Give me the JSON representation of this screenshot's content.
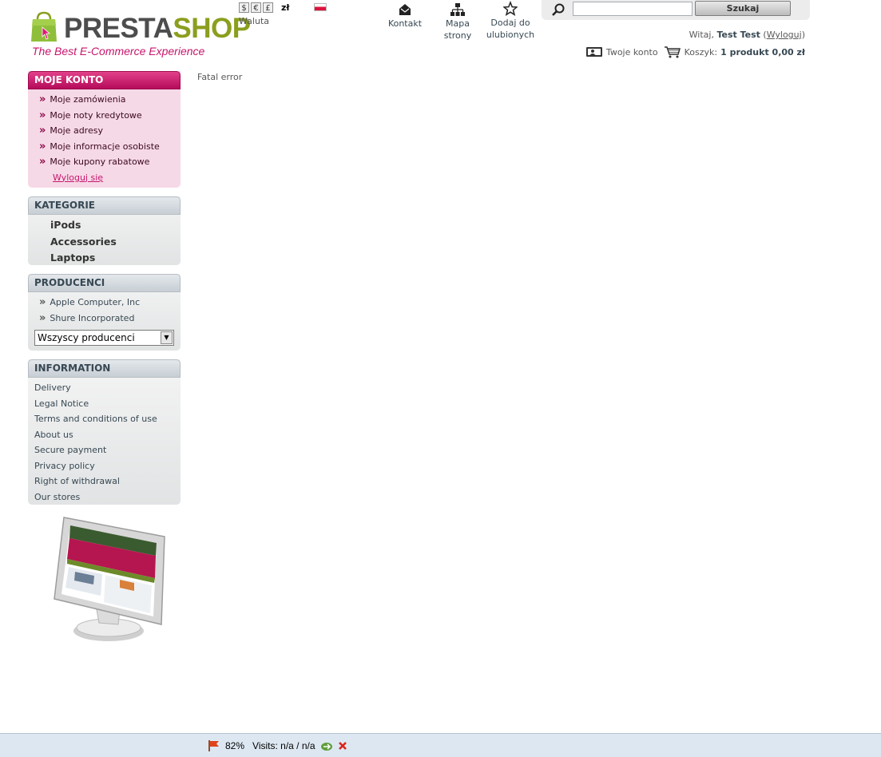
{
  "header": {
    "logo_word_1": "PRESTA",
    "logo_word_2": "SHOP",
    "logo_tagline": "The Best E-Commerce Experience",
    "currency": {
      "options": [
        "$",
        "€",
        "£"
      ],
      "selected": "zł",
      "label": "Waluta"
    },
    "links": {
      "contact": "Kontakt",
      "sitemap_1": "Mapa",
      "sitemap_2": "strony",
      "favorites_1": "Dodaj do",
      "favorites_2": "ulubionych"
    },
    "search": {
      "value": "",
      "button": "Szukaj"
    },
    "welcome": {
      "greeting": "Witaj,",
      "name": "Test Test",
      "logout": "Wyloguj"
    },
    "account_link": "Twoje konto",
    "cart": {
      "label": "Koszyk:",
      "summary": "1 produkt 0,00 zł"
    }
  },
  "my_account": {
    "title": "MOJE KONTO",
    "items": [
      "Moje zamówienia",
      "Moje noty kredytowe",
      "Moje adresy",
      "Moje informacje osobiste",
      "Moje kupony rabatowe"
    ],
    "logout": "Wyloguj się"
  },
  "categories": {
    "title": "KATEGORIE",
    "items": [
      "iPods",
      "Accessories",
      "Laptops"
    ]
  },
  "manufacturers": {
    "title": "PRODUCENCI",
    "items": [
      "Apple Computer, Inc",
      "Shure Incorporated"
    ],
    "select_value": "Wszyscy producenci"
  },
  "information": {
    "title": "INFORMATION",
    "items": [
      "Delivery",
      "Legal Notice",
      "Terms and conditions of use",
      "About us",
      "Secure payment",
      "Privacy policy",
      "Right of withdrawal",
      "Our stores"
    ]
  },
  "main": {
    "message": "Fatal error"
  },
  "statusbar": {
    "percent": "82%",
    "visits": "Visits: n/a / n/a"
  },
  "colors": {
    "brand_pink": "#c7166c",
    "brand_green": "#8c9e1e",
    "text": "#374853"
  }
}
